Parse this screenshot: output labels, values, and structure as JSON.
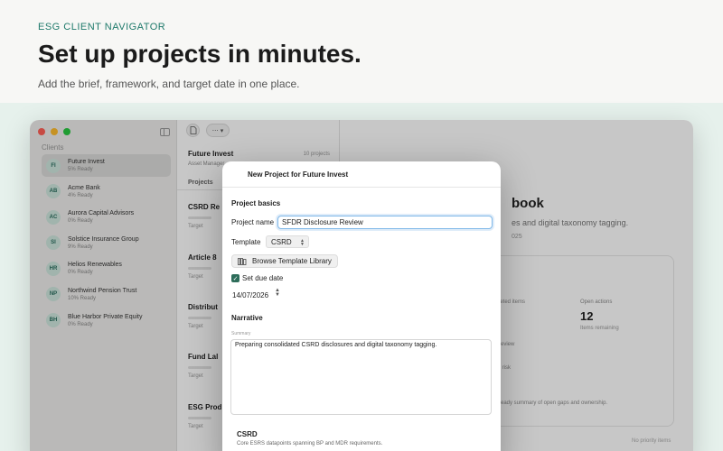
{
  "hero": {
    "eyebrow": "ESG CLIENT NAVIGATOR",
    "headline": "Set up projects in minutes.",
    "subhead": "Add the brief, framework, and target date in one place."
  },
  "colors": {
    "accent": "#1f7a6b",
    "band": "#e6f1ec",
    "checkbox": "#2d6d5a",
    "focus_ring": "#7fb8e8"
  },
  "sidebar": {
    "section_label": "Clients",
    "clients": [
      {
        "initials": "FI",
        "name": "Future Invest",
        "status": "5% Ready",
        "selected": true
      },
      {
        "initials": "AB",
        "name": "Acme Bank",
        "status": "4% Ready"
      },
      {
        "initials": "AC",
        "name": "Aurora Capital Advisors",
        "status": "0% Ready"
      },
      {
        "initials": "SI",
        "name": "Solstice Insurance Group",
        "status": "9% Ready"
      },
      {
        "initials": "HR",
        "name": "Helios Renewables",
        "status": "0% Ready"
      },
      {
        "initials": "NP",
        "name": "Northwind Pension Trust",
        "status": "10% Ready"
      },
      {
        "initials": "BH",
        "name": "Blue Harbor Private Equity",
        "status": "0% Ready"
      }
    ]
  },
  "middle": {
    "client_title": "Future Invest",
    "project_count": "10 projects",
    "client_type": "Asset Manager",
    "projects_label": "Projects",
    "projects": [
      {
        "name": "CSRD Re",
        "target": "Target"
      },
      {
        "name": "Article 8",
        "target": "Target"
      },
      {
        "name": "Distribut",
        "target": "Target"
      },
      {
        "name": "Fund Lal",
        "target": "Target"
      },
      {
        "name": "ESG Prod",
        "target": "Target"
      }
    ]
  },
  "detail": {
    "title_fragment": "book",
    "subtitle_fragment": "es and digital taxonomy tagging.",
    "date_fragment": "025",
    "stats": {
      "completed_label": "leted items",
      "open_actions_label": "Open actions",
      "open_actions_value": "12",
      "open_actions_note": "Items remaining"
    },
    "items": [
      "review",
      "r risk"
    ],
    "summary_fragment": "ready summary of open gaps and ownership.",
    "no_priority": "No priority items"
  },
  "sheet": {
    "title": "New Project for Future Invest",
    "basics_title": "Project basics",
    "name_label": "Project name",
    "name_value": "SFDR Disclosure Review",
    "template_label": "Template",
    "template_value": "CSRD",
    "browse_label": "Browse Template Library",
    "due_label": "Set due date",
    "due_checked": true,
    "due_date": "14/07/2026",
    "narrative_title": "Narrative",
    "summary_label": "Summary",
    "summary_text": "Preparing consolidated CSRD disclosures and digital taxonomy tagging.",
    "template_card": {
      "title": "CSRD",
      "description": "Core ESRS datapoints spanning BP and MDR requirements."
    }
  }
}
